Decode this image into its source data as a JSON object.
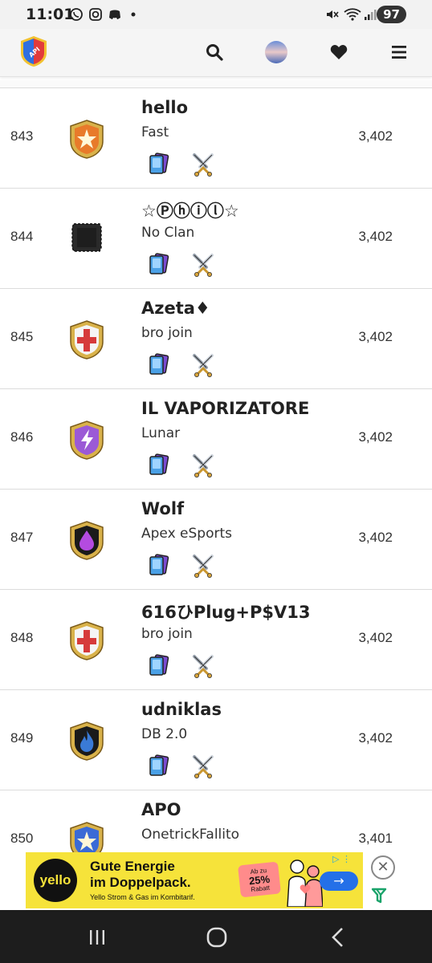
{
  "statusbar": {
    "time": "11:01",
    "battery": "97"
  },
  "header": {
    "icons": [
      "api-logo-icon",
      "search-icon",
      "avatar-icon",
      "heart-icon",
      "menu-icon"
    ]
  },
  "rows": [
    {
      "rank": "843",
      "name": "hello",
      "clan": "Fast",
      "trophies": "3,402",
      "badge": "star-shield",
      "badge_color": "#e87a2a"
    },
    {
      "rank": "844",
      "name": "☆Ⓟⓗⓘⓛ☆",
      "clan": "No Clan",
      "trophies": "3,402",
      "badge": "no-clan",
      "badge_color": "#222222"
    },
    {
      "rank": "845",
      "name": "Azeta♦",
      "clan": "bro join",
      "trophies": "3,402",
      "badge": "cross-shield",
      "badge_color": "#d63a3a"
    },
    {
      "rank": "846",
      "name": "IL VAPORIZATORE",
      "clan": "Lunar",
      "trophies": "3,402",
      "badge": "lightning-shield",
      "badge_color": "#9b59d6"
    },
    {
      "rank": "847",
      "name": "Wolf",
      "clan": "Apex eSports",
      "trophies": "3,402",
      "badge": "drop-shield",
      "badge_color": "#b44be0"
    },
    {
      "rank": "848",
      "name": "616ひPlug+P$V13",
      "clan": "bro join",
      "trophies": "3,402",
      "badge": "cross-shield",
      "badge_color": "#d63a3a"
    },
    {
      "rank": "849",
      "name": "udniklas",
      "clan": "DB 2.0",
      "trophies": "3,402",
      "badge": "flame-shield",
      "badge_color": "#3a7ad6"
    },
    {
      "rank": "850",
      "name": "APO",
      "clan": "OnetrickFallito",
      "trophies": "3,401",
      "badge": "star-shield",
      "badge_color": "#3a6ad6"
    }
  ],
  "ad": {
    "brand": "yello",
    "headline_1": "Gute Energie",
    "headline_2": "im Doppelpack.",
    "subline": "Yello Strom & Gas im Kombitarif.",
    "promo_top": "Ab zu",
    "promo_value": "25%",
    "promo_bottom": "Rabatt",
    "arrow": "→",
    "close": "✕"
  }
}
